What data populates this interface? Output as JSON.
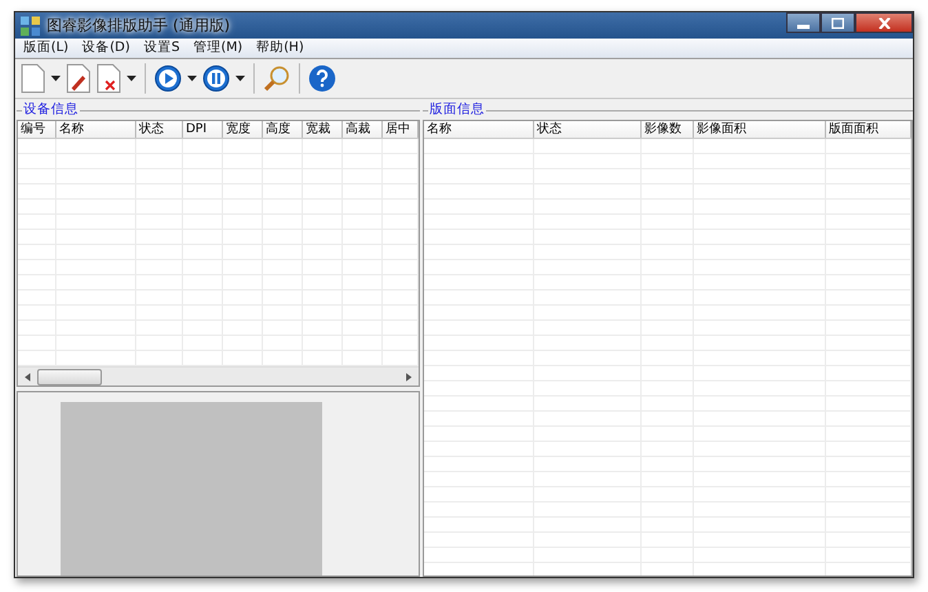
{
  "window": {
    "title": "图睿影像排版助手 (通用版)"
  },
  "menu": [
    "版面(L)",
    "设备(D)",
    "设置S",
    "管理(M)",
    "帮助(H)"
  ],
  "device_panel": {
    "title": "设备信息",
    "columns": [
      "编号",
      "名称",
      "状态",
      "DPI",
      "宽度",
      "高度",
      "宽裁",
      "高裁",
      "居中"
    ]
  },
  "layout_panel": {
    "title": "版面信息",
    "columns": [
      "名称",
      "状态",
      "影像数",
      "影像面积",
      "版面面积"
    ]
  }
}
